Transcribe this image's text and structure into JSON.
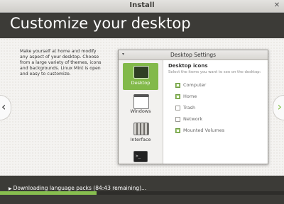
{
  "window": {
    "title": "Install"
  },
  "banner": {
    "heading": "Customize your desktop"
  },
  "description": "Make yourself at home and modify any aspect of your desktop. Choose from a large variety of themes, icons and backgrounds. Linux Mint is open and easy to customize.",
  "settings_window": {
    "title": "Desktop Settings",
    "sidebar": [
      {
        "label": "Desktop",
        "icon": "desktop-icon",
        "active": true
      },
      {
        "label": "Windows",
        "icon": "windows-icon",
        "active": false
      },
      {
        "label": "Interface",
        "icon": "interface-icon",
        "active": false
      },
      {
        "label": "",
        "icon": "terminal-icon",
        "active": false
      }
    ],
    "panel": {
      "title": "Desktop icons",
      "subtitle": "Select the items you want to see on the desktop:",
      "options": [
        {
          "label": "Computer",
          "checked": true
        },
        {
          "label": "Home",
          "checked": true
        },
        {
          "label": "Trash",
          "checked": false
        },
        {
          "label": "Network",
          "checked": false
        },
        {
          "label": "Mounted Volumes",
          "checked": true
        }
      ]
    }
  },
  "navigation": {
    "prev": "‹",
    "next": "›"
  },
  "status": {
    "text": "Downloading language packs (84:43 remaining)..."
  },
  "progress": {
    "fraction": 0.34
  },
  "colors": {
    "accent": "#87be4f",
    "banner_bg": "#3c3b37"
  }
}
